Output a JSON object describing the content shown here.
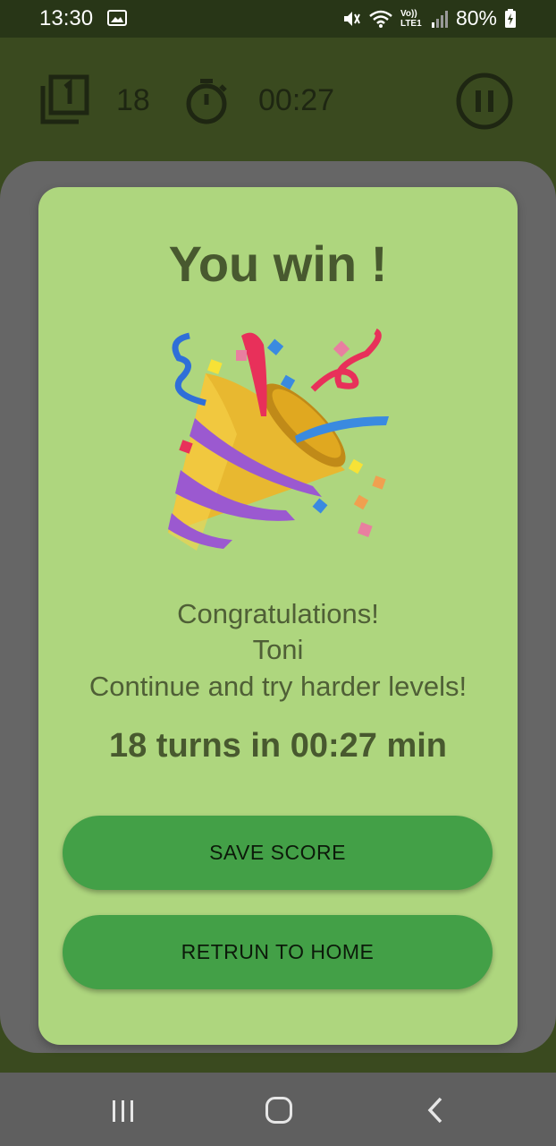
{
  "status_bar": {
    "time": "13:30",
    "network_label": "Vo)) LTE1",
    "battery": "80%",
    "icons": [
      "gallery-icon",
      "mute-icon",
      "wifi-icon",
      "signal-icon",
      "battery-charging-icon"
    ]
  },
  "header": {
    "turns": "18",
    "time": "00:27",
    "icons": [
      "cards-icon",
      "stopwatch-icon",
      "pause-icon"
    ]
  },
  "dialog": {
    "title": "You win !",
    "image": "party-popper",
    "messages": [
      "Congratulations!",
      "Toni",
      "Continue and try harder levels!"
    ],
    "summary": "18 turns in 00:27 min",
    "save_label": "SAVE SCORE",
    "home_label": "RETRUN TO HOME"
  },
  "nav": {
    "icons": [
      "recent-apps-icon",
      "home-icon",
      "back-icon"
    ]
  },
  "colors": {
    "header_bg": "#3a4a1f",
    "status_bg": "#283617",
    "dialog_bg": "#aed67e",
    "button_bg": "#43a047",
    "overlay": "#666666"
  }
}
